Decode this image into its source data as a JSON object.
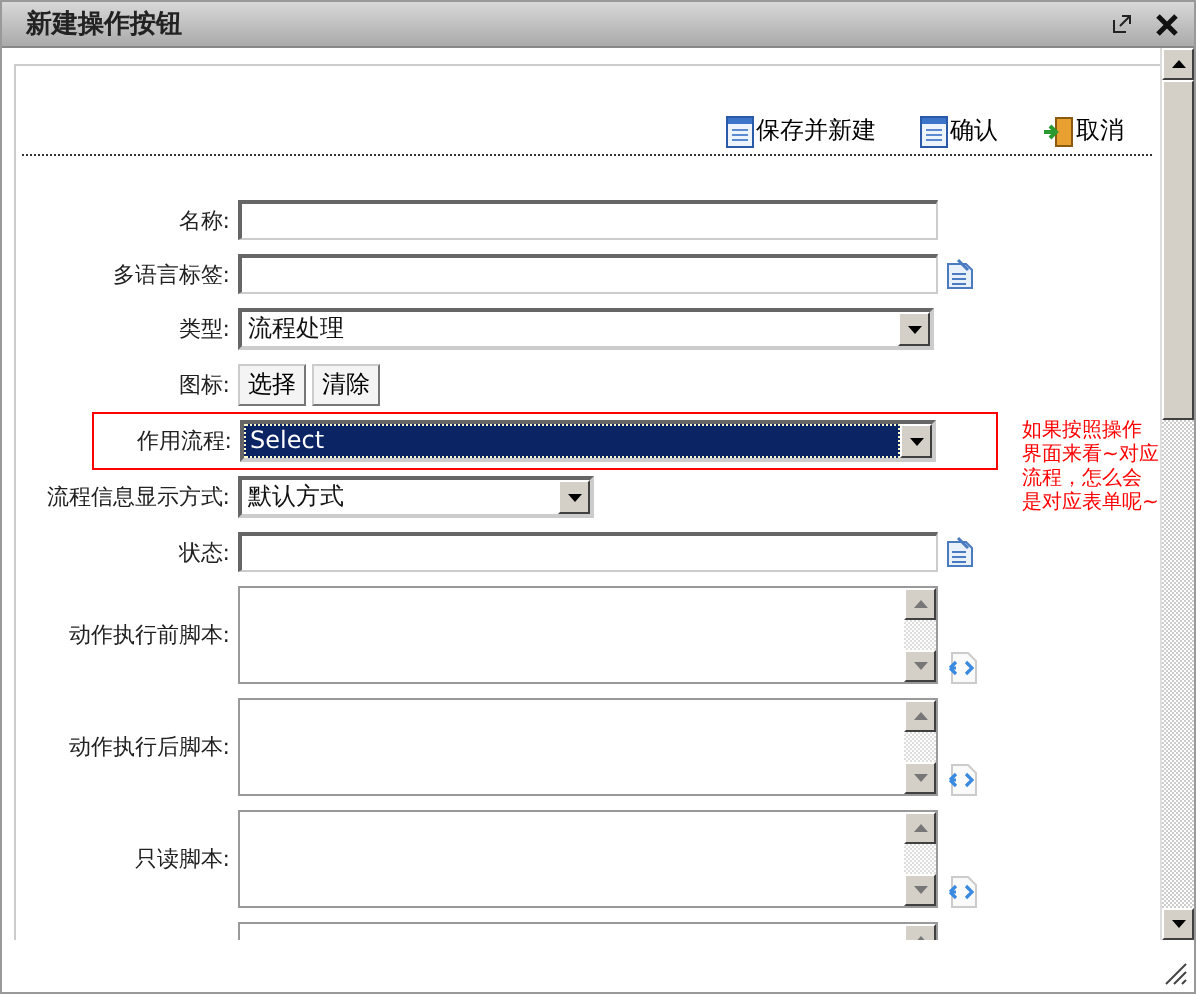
{
  "window": {
    "title": "新建操作按钮"
  },
  "toolbar": [
    {
      "kind": "save",
      "label": "保存并新建"
    },
    {
      "kind": "save",
      "label": "确认"
    },
    {
      "kind": "exit",
      "label": "取消"
    }
  ],
  "fields": [
    {
      "kind": "text",
      "label": "名称:"
    },
    {
      "kind": "notetext",
      "label": "多语言标签:"
    },
    {
      "kind": "select",
      "label": "类型:",
      "value": "流程处理",
      "focused": false
    },
    {
      "kind": "buttons",
      "label": "图标:",
      "buttons": [
        "选择",
        "清除"
      ]
    },
    {
      "kind": "select",
      "label": "作用流程:",
      "value": "Select",
      "focused": true,
      "flagged": true
    },
    {
      "kind": "shortselect",
      "label": "流程信息显示方式:",
      "value": "默认方式",
      "focused": false
    },
    {
      "kind": "notetext",
      "label": "状态:"
    },
    {
      "kind": "script",
      "label": "动作执行前脚本:"
    },
    {
      "kind": "script",
      "label": "动作执行后脚本:"
    },
    {
      "kind": "script",
      "label": "只读脚本:"
    },
    {
      "kind": "textarea"
    }
  ],
  "annotation": {
    "lines": [
      "如果按照操作",
      "界面来看~对应",
      "流程，怎么会",
      "是对应表单呢~"
    ]
  }
}
